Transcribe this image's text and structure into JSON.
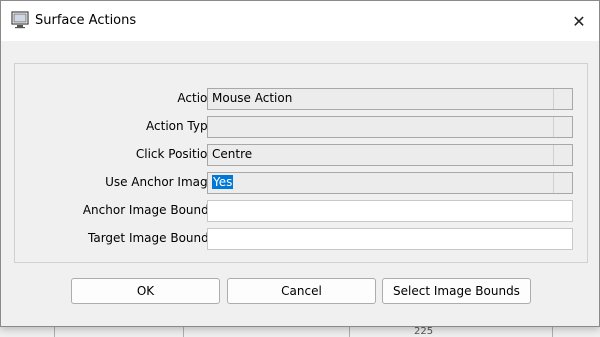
{
  "window": {
    "title": "Surface Actions",
    "close_glyph": "✕"
  },
  "form": {
    "rows": [
      {
        "label": "Action",
        "value": "Mouse Action",
        "kind": "combo"
      },
      {
        "label": "Action Type",
        "value": "",
        "kind": "combo"
      },
      {
        "label": "Click Position",
        "value": "Centre",
        "kind": "combo"
      },
      {
        "label": "Use Anchor Image",
        "value": "Yes",
        "kind": "combo",
        "selected": true
      },
      {
        "label": "Anchor Image Bounds",
        "value": "",
        "kind": "text"
      },
      {
        "label": "Target Image Bounds",
        "value": "",
        "kind": "text"
      }
    ]
  },
  "buttons": {
    "ok": "OK",
    "cancel": "Cancel",
    "select_bounds": "Select Image Bounds"
  },
  "background": {
    "fragment": "225"
  },
  "colors": {
    "selection": "#0078d7",
    "dialog_bg": "#f0f0f0",
    "titlebar_bg": "#ffffff"
  },
  "icons": {
    "app": "app-window-icon",
    "close": "close-icon"
  }
}
